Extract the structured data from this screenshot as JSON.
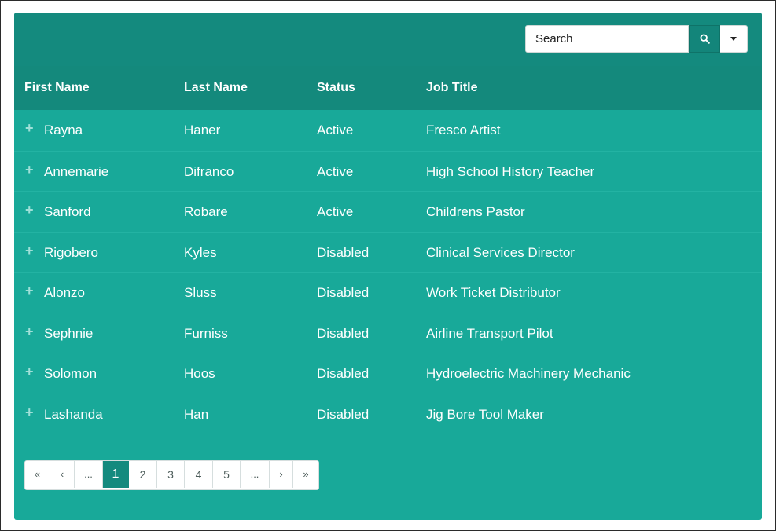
{
  "search": {
    "placeholder": "Search",
    "search_button_icon": "search-icon",
    "dropdown_icon": "caret-down-icon"
  },
  "table": {
    "headers": [
      "First Name",
      "Last Name",
      "Status",
      "Job Title"
    ],
    "expand_icon": "+",
    "rows": [
      {
        "first": "Rayna",
        "last": "Haner",
        "status": "Active",
        "job": "Fresco Artist"
      },
      {
        "first": "Annemarie",
        "last": "Difranco",
        "status": "Active",
        "job": "High School History Teacher"
      },
      {
        "first": "Sanford",
        "last": "Robare",
        "status": "Active",
        "job": "Childrens Pastor"
      },
      {
        "first": "Rigobero",
        "last": "Kyles",
        "status": "Disabled",
        "job": "Clinical Services Director"
      },
      {
        "first": "Alonzo",
        "last": "Sluss",
        "status": "Disabled",
        "job": "Work Ticket Distributor"
      },
      {
        "first": "Sephnie",
        "last": "Furniss",
        "status": "Disabled",
        "job": "Airline Transport Pilot"
      },
      {
        "first": "Solomon",
        "last": "Hoos",
        "status": "Disabled",
        "job": "Hydroelectric Machinery Mechanic"
      },
      {
        "first": "Lashanda",
        "last": "Han",
        "status": "Disabled",
        "job": "Jig Bore Tool Maker"
      }
    ]
  },
  "pagination": {
    "first": "«",
    "prev": "‹",
    "ellipsis_left": "...",
    "pages": [
      "1",
      "2",
      "3",
      "4",
      "5"
    ],
    "current_page": "1",
    "ellipsis_right": "...",
    "next": "›",
    "last": "»"
  },
  "colors": {
    "panel": "#18a999",
    "header": "#148a7e",
    "text": "#ffffff",
    "active_page": "#148a7e"
  }
}
